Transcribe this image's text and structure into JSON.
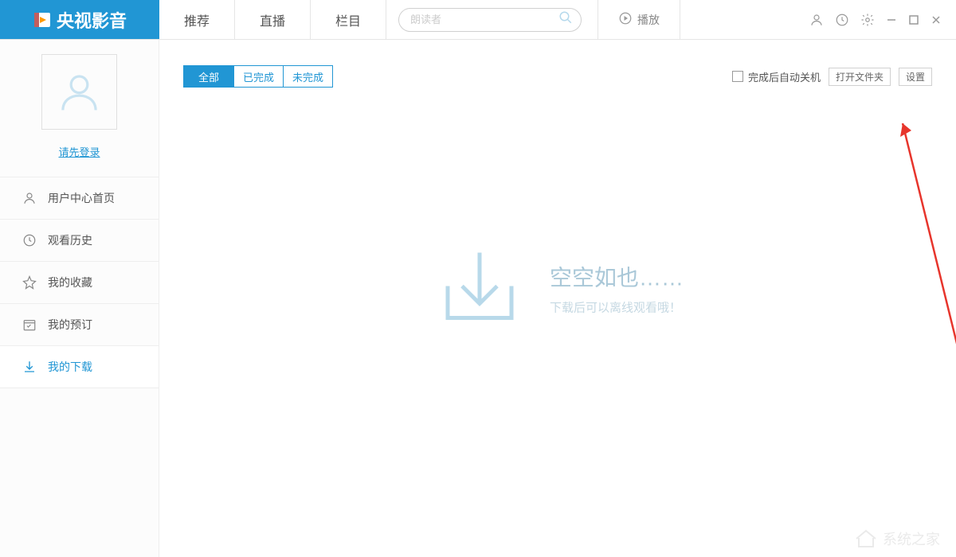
{
  "header": {
    "app_name": "央视影音",
    "tabs": [
      "推荐",
      "直播",
      "栏目"
    ],
    "search_placeholder": "朗读者",
    "play_label": "播放"
  },
  "sidebar": {
    "login_prompt": "请先登录",
    "items": [
      {
        "label": "用户中心首页",
        "icon": "user"
      },
      {
        "label": "观看历史",
        "icon": "history"
      },
      {
        "label": "我的收藏",
        "icon": "star"
      },
      {
        "label": "我的预订",
        "icon": "calendar"
      },
      {
        "label": "我的下载",
        "icon": "download"
      }
    ]
  },
  "main": {
    "filters": [
      "全部",
      "已完成",
      "未完成"
    ],
    "active_filter": 0,
    "shutdown_checkbox_label": "完成后自动关机",
    "open_folder_label": "打开文件夹",
    "settings_label": "设置",
    "empty_title": "空空如也……",
    "empty_subtitle": "下载后可以离线观看哦！"
  },
  "watermark": "系统之家"
}
